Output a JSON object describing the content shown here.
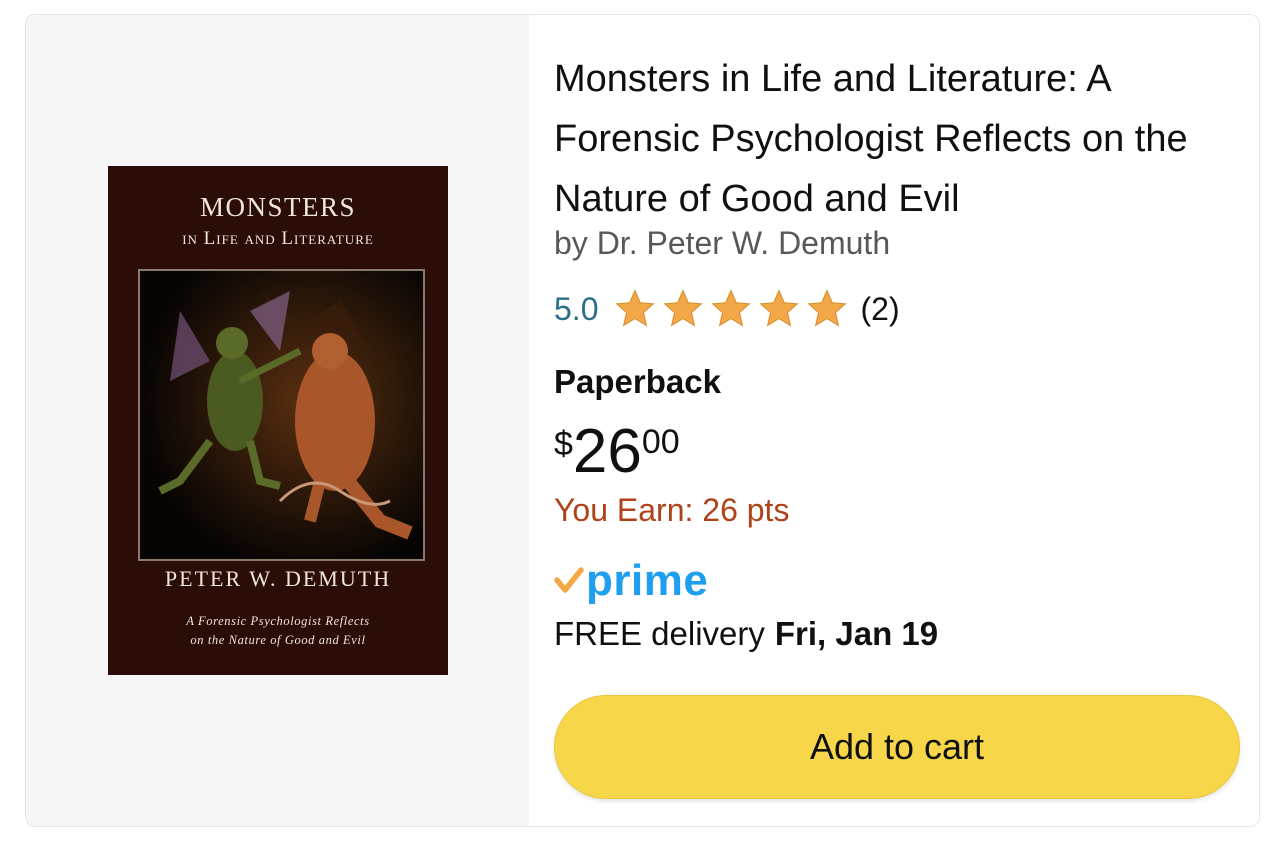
{
  "product": {
    "title": "Monsters in Life and Literature: A Forensic Psychologist Reflects on the Nature of Good and Evil",
    "author": "by Dr. Peter W. Demuth",
    "rating": {
      "value": "5.0",
      "stars": 5,
      "count": "(2)",
      "star_color": "#f3a847"
    },
    "format": "Paperback",
    "price": {
      "symbol": "$",
      "whole": "26",
      "fraction": "00"
    },
    "earn_points": "You Earn: 26 pts",
    "prime": {
      "label": "prime",
      "check_color": "#f3a847",
      "text_color": "#1f9ff0"
    },
    "delivery": {
      "label": "FREE delivery",
      "date": "Fri, Jan 19"
    },
    "add_to_cart_label": "Add to cart"
  },
  "cover": {
    "title": "MONSTERS",
    "subtitle": "in Life and Literature",
    "author": "PETER W. DEMUTH",
    "tagline_line1": "A Forensic Psychologist Reflects",
    "tagline_line2": "on the Nature of Good and Evil"
  },
  "colors": {
    "button": "#f7d749",
    "rating_link": "#2a6f88",
    "earn_text": "#b0421a"
  }
}
